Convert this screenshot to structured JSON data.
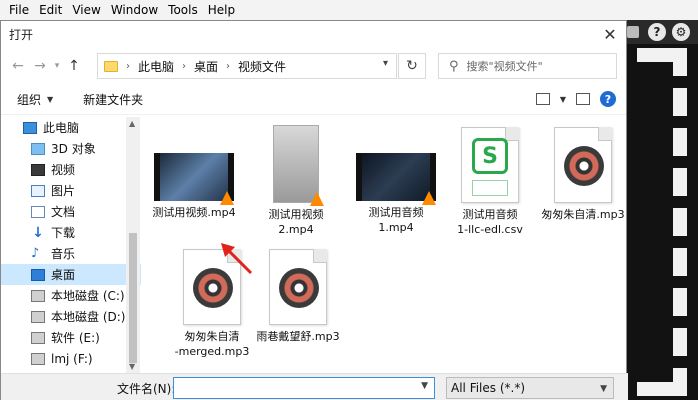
{
  "menubar": {
    "items": [
      "File",
      "Edit",
      "View",
      "Window",
      "Tools",
      "Help"
    ]
  },
  "app_right": {
    "icons": [
      "question-icon",
      "gear-icon"
    ],
    "question": "?",
    "gear": "⚙"
  },
  "dialog": {
    "title": "打开",
    "close": "✕",
    "nav": {
      "back": "←",
      "forward": "→",
      "up": "↑"
    },
    "breadcrumb": [
      "此电脑",
      "桌面",
      "视频文件"
    ],
    "refresh": "↻",
    "search_icon": "⚲",
    "search_placeholder": "搜索\"视频文件\"",
    "toolbar": {
      "organize": "组织",
      "new_folder": "新建文件夹",
      "help": "?"
    },
    "sidebar": [
      {
        "label": "此电脑",
        "icon": "computer-icon"
      },
      {
        "label": "3D 对象",
        "icon": "3d-objects-icon"
      },
      {
        "label": "视频",
        "icon": "video-folder-icon"
      },
      {
        "label": "图片",
        "icon": "pictures-icon"
      },
      {
        "label": "文档",
        "icon": "documents-icon"
      },
      {
        "label": "下载",
        "icon": "download-icon"
      },
      {
        "label": "音乐",
        "icon": "music-icon"
      },
      {
        "label": "桌面",
        "icon": "desktop-icon",
        "selected": true
      },
      {
        "label": "本地磁盘 (C:)",
        "icon": "drive-icon"
      },
      {
        "label": "本地磁盘 (D:)",
        "icon": "drive-icon"
      },
      {
        "label": "软件 (E:)",
        "icon": "drive-icon"
      },
      {
        "label": "lmj (F:)",
        "icon": "drive-icon"
      }
    ],
    "files": [
      {
        "lines": [
          "测试用视频.mp4"
        ],
        "type": "video"
      },
      {
        "lines": [
          "测试用视频",
          "2.mp4"
        ],
        "type": "portrait-video"
      },
      {
        "lines": [
          "测试用音频",
          "1.mp4"
        ],
        "type": "video-dark"
      },
      {
        "lines": [
          "测试用音频",
          "1-llc-edl.csv"
        ],
        "type": "csv"
      },
      {
        "lines": [
          "匆匆朱自清.mp3"
        ],
        "type": "audio"
      },
      {
        "lines": [
          "匆匆朱自清",
          "-merged.mp3"
        ],
        "type": "audio"
      },
      {
        "lines": [
          "雨巷戴望舒.mp3"
        ],
        "type": "audio"
      }
    ],
    "wps_glyph": "S",
    "filename_label": "文件名(N):",
    "filename_value": "",
    "filetype": "All Files (*.*)"
  }
}
